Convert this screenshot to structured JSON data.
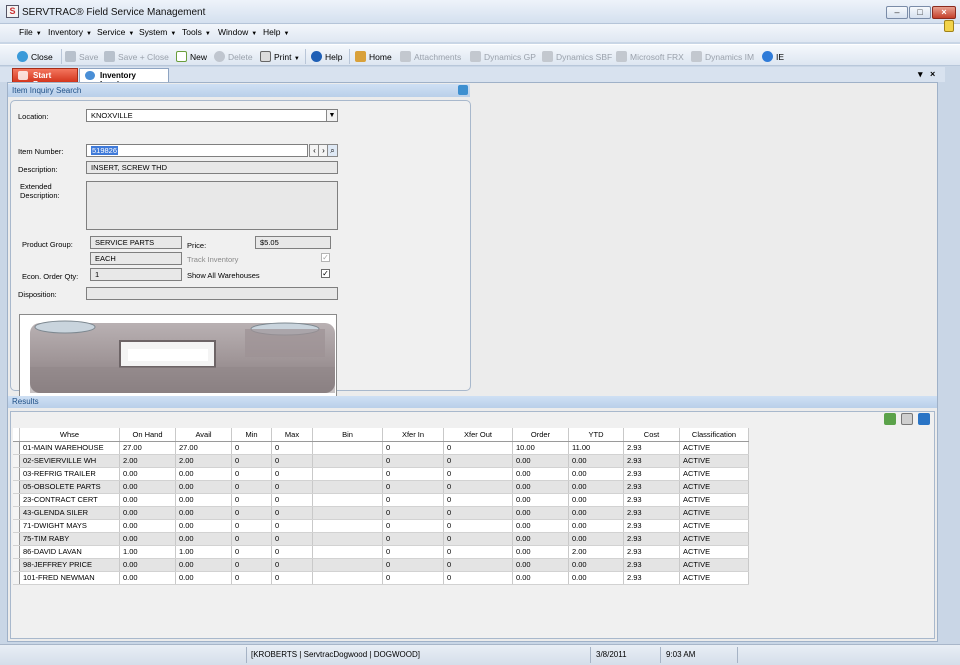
{
  "window": {
    "title": "SERVTRAC® Field Service Management",
    "minimize": "–",
    "maximize": "□",
    "close": "×"
  },
  "menu": [
    "File",
    "Inventory",
    "Service",
    "System",
    "Tools",
    "Window",
    "Help"
  ],
  "toolbar": {
    "close": "Close",
    "save": "Save",
    "save_close": "Save + Close",
    "new": "New",
    "delete": "Delete",
    "print": "Print",
    "help": "Help",
    "home": "Home",
    "attachments": "Attachments",
    "dynamics_gp": "Dynamics GP",
    "dynamics_sbf": "Dynamics SBF",
    "microsoft_frx": "Microsoft FRX",
    "dynamics_im": "Dynamics IM",
    "ie": "IE"
  },
  "tabs": {
    "start_page": "Start Page",
    "inventory_inquiry": "Inventory Inquiry"
  },
  "search": {
    "header": "Item Inquiry Search",
    "location_label": "Location:",
    "location_value": "KNOXVILLE",
    "item_number_label": "Item Number:",
    "item_number_value": "519826",
    "description_label": "Description:",
    "description_value": "INSERT, SCREW THD",
    "extended_description_label_1": "Extended",
    "extended_description_label_2": "Description:",
    "extended_description_value": "",
    "product_group_label": "Product Group:",
    "product_group_value": "SERVICE PARTS",
    "uom_value": "EACH",
    "price_label": "Price:",
    "price_value": "$5.05",
    "track_inventory_label": "Track Inventory",
    "track_inventory_checked": true,
    "econ_order_qty_label": "Econ. Order Qty:",
    "econ_order_qty_value": "1",
    "show_all_warehouses_label": "Show All Warehouses",
    "show_all_warehouses_checked": true,
    "disposition_label": "Disposition:",
    "disposition_value": ""
  },
  "results": {
    "header": "Results",
    "columns": [
      "Whse",
      "On Hand",
      "Avail",
      "Min",
      "Max",
      "Bin",
      "Xfer In",
      "Xfer Out",
      "Order",
      "YTD",
      "Cost",
      "Classification"
    ],
    "rows": [
      [
        "01-MAIN WAREHOUSE",
        "27.00",
        "27.00",
        "0",
        "0",
        "",
        "0",
        "0",
        "10.00",
        "11.00",
        "2.93",
        "ACTIVE"
      ],
      [
        "02-SEVIERVILLE WH",
        "2.00",
        "2.00",
        "0",
        "0",
        "",
        "0",
        "0",
        "0.00",
        "0.00",
        "2.93",
        "ACTIVE"
      ],
      [
        "03-REFRIG TRAILER",
        "0.00",
        "0.00",
        "0",
        "0",
        "",
        "0",
        "0",
        "0.00",
        "0.00",
        "2.93",
        "ACTIVE"
      ],
      [
        "05-OBSOLETE PARTS",
        "0.00",
        "0.00",
        "0",
        "0",
        "",
        "0",
        "0",
        "0.00",
        "0.00",
        "2.93",
        "ACTIVE"
      ],
      [
        "23-CONTRACT CERT",
        "0.00",
        "0.00",
        "0",
        "0",
        "",
        "0",
        "0",
        "0.00",
        "0.00",
        "2.93",
        "ACTIVE"
      ],
      [
        "43-GLENDA SILER",
        "0.00",
        "0.00",
        "0",
        "0",
        "",
        "0",
        "0",
        "0.00",
        "0.00",
        "2.93",
        "ACTIVE"
      ],
      [
        "71-DWIGHT MAYS",
        "0.00",
        "0.00",
        "0",
        "0",
        "",
        "0",
        "0",
        "0.00",
        "0.00",
        "2.93",
        "ACTIVE"
      ],
      [
        "75-TIM RABY",
        "0.00",
        "0.00",
        "0",
        "0",
        "",
        "0",
        "0",
        "0.00",
        "0.00",
        "2.93",
        "ACTIVE"
      ],
      [
        "86-DAVID LAVAN",
        "1.00",
        "1.00",
        "0",
        "0",
        "",
        "0",
        "0",
        "0.00",
        "2.00",
        "2.93",
        "ACTIVE"
      ],
      [
        "98-JEFFREY PRICE",
        "0.00",
        "0.00",
        "0",
        "0",
        "",
        "0",
        "0",
        "0.00",
        "0.00",
        "2.93",
        "ACTIVE"
      ],
      [
        "101-FRED NEWMAN",
        "0.00",
        "0.00",
        "0",
        "0",
        "",
        "0",
        "0",
        "0.00",
        "0.00",
        "2.93",
        "ACTIVE"
      ]
    ]
  },
  "status": {
    "session": "[KROBERTS | ServtracDogwood | DOGWOOD]",
    "date": "3/8/2011",
    "time": "9:03 AM"
  },
  "colors": {
    "accent": "#3f7ad9",
    "section_header": "#1e4f86",
    "start_tab": "#d4361d"
  }
}
